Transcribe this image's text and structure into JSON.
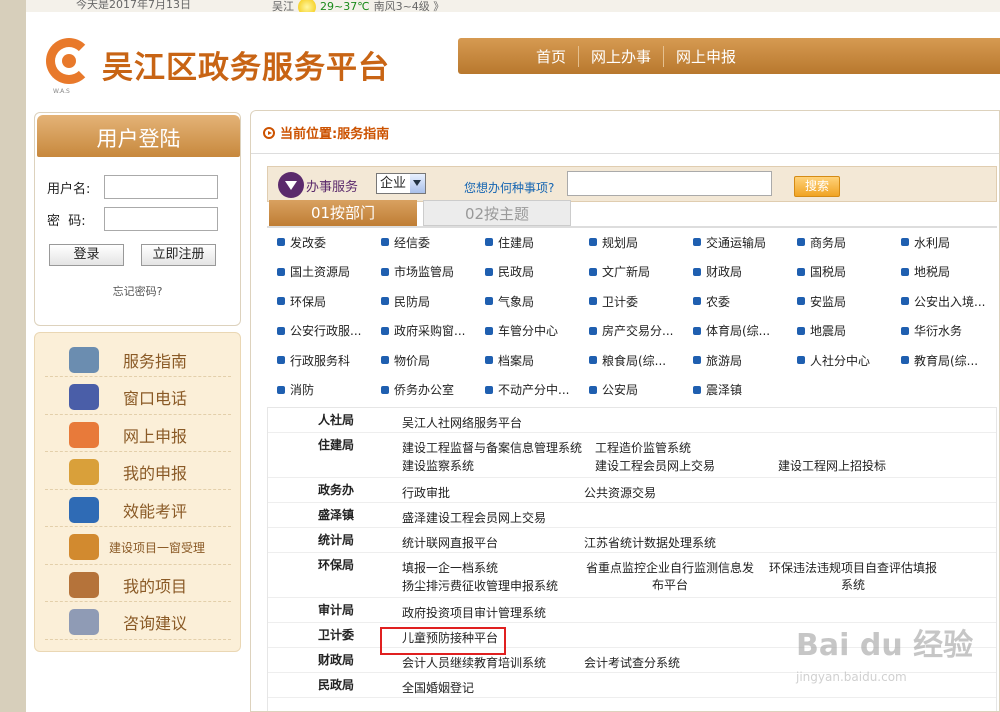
{
  "topbar": {
    "date": "今天是2017年7月13日",
    "city": "吴江",
    "temp": "29~37℃",
    "wind": "南风3~4级 》"
  },
  "header": {
    "title": "吴江区政务服务平台",
    "logo_sub": "W.A.S",
    "nav": [
      "首页",
      "网上办事",
      "网上申报"
    ]
  },
  "login": {
    "title": "用户登陆",
    "user_label": "用户名:",
    "pass_label": "密  码:",
    "login_btn": "登录",
    "register_btn": "立即注册",
    "forgot": "忘记密码?"
  },
  "menu": [
    {
      "label": "服务指南",
      "icon": "laptop-icon"
    },
    {
      "label": "窗口电话",
      "icon": "users-icon"
    },
    {
      "label": "网上申报",
      "icon": "monitor-icon"
    },
    {
      "label": "我的申报",
      "icon": "stack-icon"
    },
    {
      "label": "效能考评",
      "icon": "globe-icon"
    },
    {
      "label": "建设项目一窗受理",
      "icon": "briefcase-icon"
    },
    {
      "label": "我的项目",
      "icon": "book-icon"
    },
    {
      "label": "咨询建议",
      "icon": "people-icon"
    }
  ],
  "breadcrumb": "当前位置:服务指南",
  "search": {
    "label": "办事服务",
    "select_value": "企业",
    "question": "您想办何种事项?",
    "button": "搜索"
  },
  "tabs": [
    "01按部门",
    "02按主题"
  ],
  "departments": [
    "发改委",
    "经信委",
    "住建局",
    "规划局",
    "交通运输局",
    "商务局",
    "水利局",
    "国土资源局",
    "市场监管局",
    "民政局",
    "文广新局",
    "财政局",
    "国税局",
    "地税局",
    "环保局",
    "民防局",
    "气象局",
    "卫计委",
    "农委",
    "安监局",
    "公安出入境...",
    "公安行政服...",
    "政府采购窗...",
    "车管分中心",
    "房产交易分...",
    "体育局(综...",
    "地震局",
    "华衍水务",
    "行政服务科",
    "物价局",
    "档案局",
    "粮食局(综...",
    "旅游局",
    "人社分中心",
    "教育局(综...",
    "消防",
    "侨务办公室",
    "不动产分中...",
    "公安局",
    "震泽镇"
  ],
  "systems": [
    {
      "dept": "人社局",
      "links": [
        "吴江人社网络服务平台"
      ]
    },
    {
      "dept": "住建局",
      "links": [
        "建设工程监督与备案信息管理系统",
        "工程造价监管系统",
        "建设监察系统",
        "建设工程会员网上交易",
        "建设工程网上招投标"
      ]
    },
    {
      "dept": "政务办",
      "links": [
        "行政审批",
        "公共资源交易"
      ]
    },
    {
      "dept": "盛泽镇",
      "links": [
        "盛泽建设工程会员网上交易"
      ]
    },
    {
      "dept": "统计局",
      "links": [
        "统计联网直报平台",
        "江苏省统计数据处理系统"
      ]
    },
    {
      "dept": "环保局",
      "links": [
        "填报一企一档系统",
        "扬尘排污费征收管理申报系统",
        "省重点监控企业自行监测信息发布平台",
        "环保违法违规项目自查评估填报系统"
      ]
    },
    {
      "dept": "审计局",
      "links": [
        "政府投资项目审计管理系统"
      ]
    },
    {
      "dept": "卫计委",
      "links": [
        "儿童预防接种平台"
      ]
    },
    {
      "dept": "财政局",
      "links": [
        "会计人员继续教育培训系统",
        "会计考试查分系统"
      ]
    },
    {
      "dept": "民政局",
      "links": [
        "全国婚姻登记"
      ]
    }
  ],
  "watermark": {
    "brand": "Bai du 经验",
    "url": "jingyan.baidu.com"
  },
  "colors": {
    "brand_orange": "#c86414",
    "nav_brown": "#c48540",
    "link_blue": "#1565b2",
    "highlight_red": "#e02020"
  }
}
